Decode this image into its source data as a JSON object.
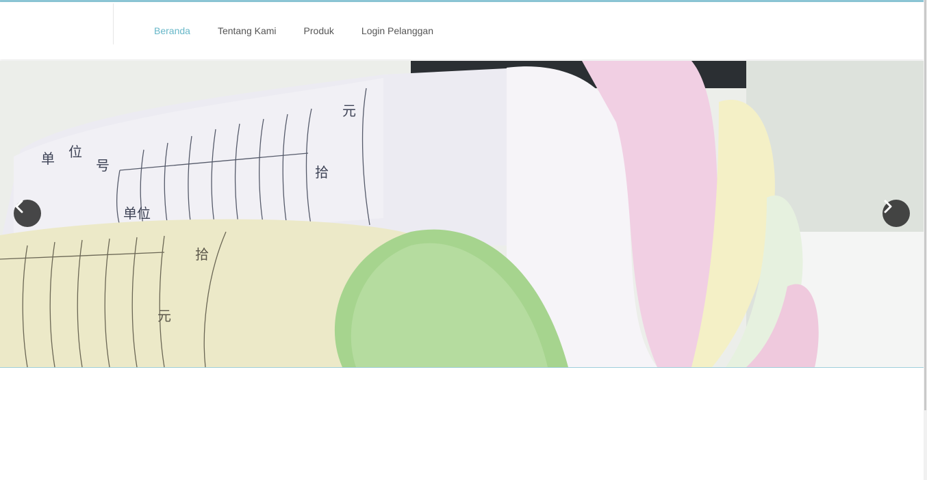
{
  "nav": {
    "items": [
      {
        "label": "Beranda",
        "active": true
      },
      {
        "label": "Tentang Kami",
        "active": false
      },
      {
        "label": "Produk",
        "active": false
      },
      {
        "label": "Login Pelanggan",
        "active": false
      }
    ]
  },
  "slider": {
    "prev_icon": "chevron-left-icon",
    "next_icon": "chevron-right-icon"
  },
  "colors": {
    "accent": "#67b7c8",
    "nav_text": "#555555",
    "arrow_bg": "#282828"
  }
}
